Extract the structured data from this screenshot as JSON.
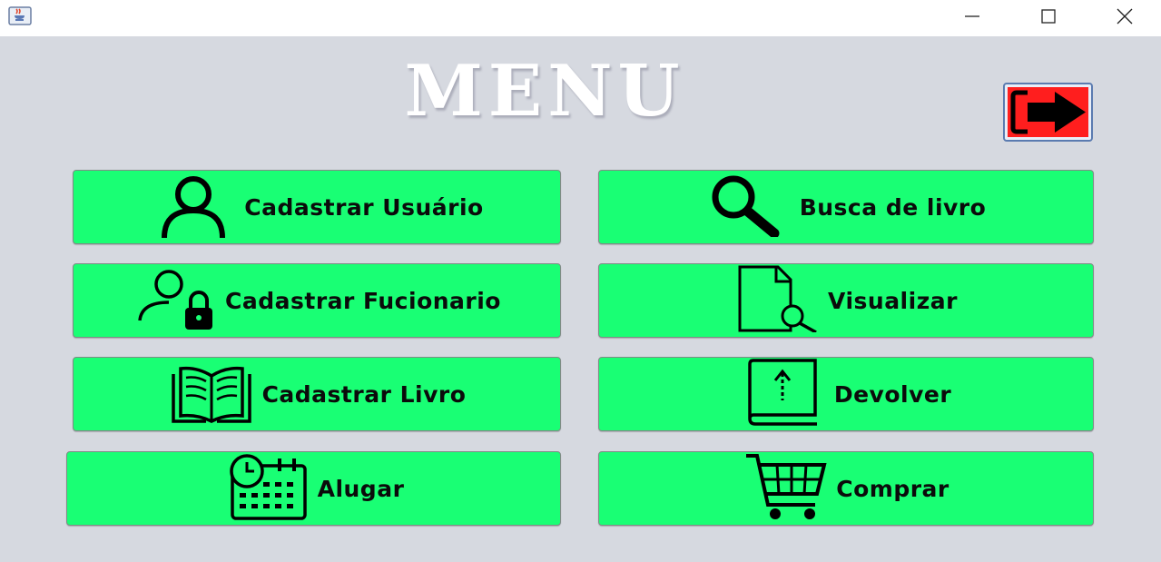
{
  "window": {
    "app_icon": "java-cup-icon",
    "controls": [
      "minimize-icon",
      "maximize-icon",
      "close-icon"
    ]
  },
  "title": "MENU",
  "exit_button": {
    "icon": "exit-arrow-icon",
    "color": "#ff1e1e"
  },
  "buttons": {
    "cadastrar_usuario": "Cadastrar Usuário",
    "busca_livro": "Busca de livro",
    "cadastrar_funcionario": "Cadastrar Fucionario",
    "visualizar": "Visualizar",
    "cadastrar_livro": "Cadastrar Livro",
    "devolver": "Devolver",
    "alugar": "Alugar",
    "comprar": "Comprar"
  },
  "colors": {
    "button_bg": "#19ff74",
    "background": "#d6d9e0",
    "title": "#ffffff"
  }
}
